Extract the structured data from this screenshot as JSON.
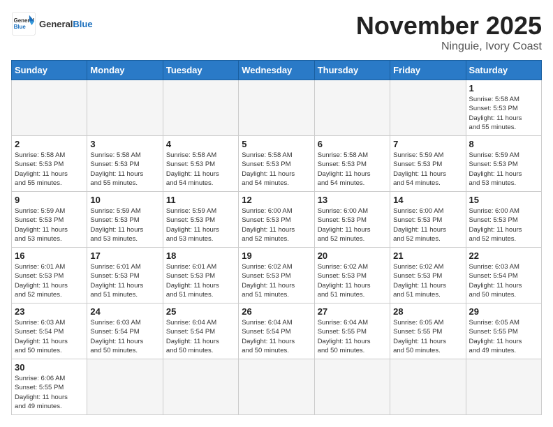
{
  "header": {
    "logo_general": "General",
    "logo_blue": "Blue",
    "month_title": "November 2025",
    "subtitle": "Ninguie, Ivory Coast"
  },
  "days_of_week": [
    "Sunday",
    "Monday",
    "Tuesday",
    "Wednesday",
    "Thursday",
    "Friday",
    "Saturday"
  ],
  "weeks": [
    [
      {
        "day": "",
        "info": ""
      },
      {
        "day": "",
        "info": ""
      },
      {
        "day": "",
        "info": ""
      },
      {
        "day": "",
        "info": ""
      },
      {
        "day": "",
        "info": ""
      },
      {
        "day": "",
        "info": ""
      },
      {
        "day": "1",
        "info": "Sunrise: 5:58 AM\nSunset: 5:53 PM\nDaylight: 11 hours\nand 55 minutes."
      }
    ],
    [
      {
        "day": "2",
        "info": "Sunrise: 5:58 AM\nSunset: 5:53 PM\nDaylight: 11 hours\nand 55 minutes."
      },
      {
        "day": "3",
        "info": "Sunrise: 5:58 AM\nSunset: 5:53 PM\nDaylight: 11 hours\nand 55 minutes."
      },
      {
        "day": "4",
        "info": "Sunrise: 5:58 AM\nSunset: 5:53 PM\nDaylight: 11 hours\nand 54 minutes."
      },
      {
        "day": "5",
        "info": "Sunrise: 5:58 AM\nSunset: 5:53 PM\nDaylight: 11 hours\nand 54 minutes."
      },
      {
        "day": "6",
        "info": "Sunrise: 5:58 AM\nSunset: 5:53 PM\nDaylight: 11 hours\nand 54 minutes."
      },
      {
        "day": "7",
        "info": "Sunrise: 5:59 AM\nSunset: 5:53 PM\nDaylight: 11 hours\nand 54 minutes."
      },
      {
        "day": "8",
        "info": "Sunrise: 5:59 AM\nSunset: 5:53 PM\nDaylight: 11 hours\nand 53 minutes."
      }
    ],
    [
      {
        "day": "9",
        "info": "Sunrise: 5:59 AM\nSunset: 5:53 PM\nDaylight: 11 hours\nand 53 minutes."
      },
      {
        "day": "10",
        "info": "Sunrise: 5:59 AM\nSunset: 5:53 PM\nDaylight: 11 hours\nand 53 minutes."
      },
      {
        "day": "11",
        "info": "Sunrise: 5:59 AM\nSunset: 5:53 PM\nDaylight: 11 hours\nand 53 minutes."
      },
      {
        "day": "12",
        "info": "Sunrise: 6:00 AM\nSunset: 5:53 PM\nDaylight: 11 hours\nand 52 minutes."
      },
      {
        "day": "13",
        "info": "Sunrise: 6:00 AM\nSunset: 5:53 PM\nDaylight: 11 hours\nand 52 minutes."
      },
      {
        "day": "14",
        "info": "Sunrise: 6:00 AM\nSunset: 5:53 PM\nDaylight: 11 hours\nand 52 minutes."
      },
      {
        "day": "15",
        "info": "Sunrise: 6:00 AM\nSunset: 5:53 PM\nDaylight: 11 hours\nand 52 minutes."
      }
    ],
    [
      {
        "day": "16",
        "info": "Sunrise: 6:01 AM\nSunset: 5:53 PM\nDaylight: 11 hours\nand 52 minutes."
      },
      {
        "day": "17",
        "info": "Sunrise: 6:01 AM\nSunset: 5:53 PM\nDaylight: 11 hours\nand 51 minutes."
      },
      {
        "day": "18",
        "info": "Sunrise: 6:01 AM\nSunset: 5:53 PM\nDaylight: 11 hours\nand 51 minutes."
      },
      {
        "day": "19",
        "info": "Sunrise: 6:02 AM\nSunset: 5:53 PM\nDaylight: 11 hours\nand 51 minutes."
      },
      {
        "day": "20",
        "info": "Sunrise: 6:02 AM\nSunset: 5:53 PM\nDaylight: 11 hours\nand 51 minutes."
      },
      {
        "day": "21",
        "info": "Sunrise: 6:02 AM\nSunset: 5:53 PM\nDaylight: 11 hours\nand 51 minutes."
      },
      {
        "day": "22",
        "info": "Sunrise: 6:03 AM\nSunset: 5:54 PM\nDaylight: 11 hours\nand 50 minutes."
      }
    ],
    [
      {
        "day": "23",
        "info": "Sunrise: 6:03 AM\nSunset: 5:54 PM\nDaylight: 11 hours\nand 50 minutes."
      },
      {
        "day": "24",
        "info": "Sunrise: 6:03 AM\nSunset: 5:54 PM\nDaylight: 11 hours\nand 50 minutes."
      },
      {
        "day": "25",
        "info": "Sunrise: 6:04 AM\nSunset: 5:54 PM\nDaylight: 11 hours\nand 50 minutes."
      },
      {
        "day": "26",
        "info": "Sunrise: 6:04 AM\nSunset: 5:54 PM\nDaylight: 11 hours\nand 50 minutes."
      },
      {
        "day": "27",
        "info": "Sunrise: 6:04 AM\nSunset: 5:55 PM\nDaylight: 11 hours\nand 50 minutes."
      },
      {
        "day": "28",
        "info": "Sunrise: 6:05 AM\nSunset: 5:55 PM\nDaylight: 11 hours\nand 50 minutes."
      },
      {
        "day": "29",
        "info": "Sunrise: 6:05 AM\nSunset: 5:55 PM\nDaylight: 11 hours\nand 49 minutes."
      }
    ],
    [
      {
        "day": "30",
        "info": "Sunrise: 6:06 AM\nSunset: 5:55 PM\nDaylight: 11 hours\nand 49 minutes."
      },
      {
        "day": "",
        "info": ""
      },
      {
        "day": "",
        "info": ""
      },
      {
        "day": "",
        "info": ""
      },
      {
        "day": "",
        "info": ""
      },
      {
        "day": "",
        "info": ""
      },
      {
        "day": "",
        "info": ""
      }
    ]
  ]
}
